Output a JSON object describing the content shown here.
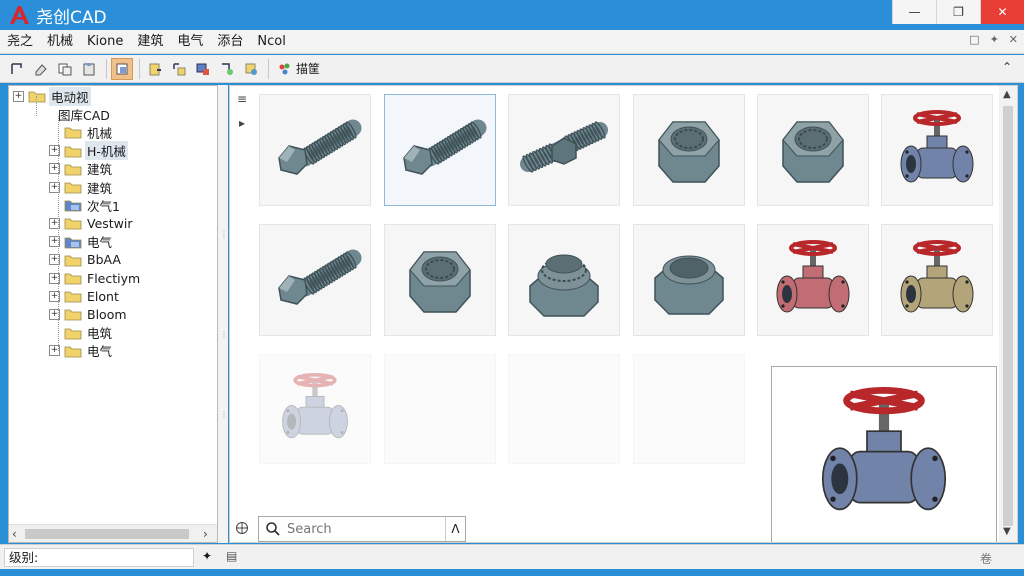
{
  "app": {
    "title": "尧创CAD",
    "accent": "#2a8fd8",
    "logo_color": "#d9262b"
  },
  "window_controls": [
    "minimize",
    "restore",
    "close"
  ],
  "menu": {
    "items": [
      "尧之",
      "机械",
      "Kione",
      "建筑",
      "电气",
      "添台",
      "Ncol"
    ]
  },
  "toolbar": {
    "label_button": "描筐"
  },
  "tree": {
    "items": [
      {
        "label": "电动视",
        "level": 0,
        "expander": "+",
        "icon": "folder"
      },
      {
        "label": "图库CAD",
        "level": 1,
        "expander": "",
        "icon": "none"
      },
      {
        "label": "机械",
        "level": 2,
        "expander": "",
        "icon": "folder"
      },
      {
        "label": "H-机械",
        "level": 2,
        "expander": "+",
        "icon": "folder"
      },
      {
        "label": "建筑",
        "level": 2,
        "expander": "+",
        "icon": "folder"
      },
      {
        "label": "建筑",
        "level": 2,
        "expander": "+",
        "icon": "folder"
      },
      {
        "label": "次气1",
        "level": 2,
        "expander": "",
        "icon": "blue-folder"
      },
      {
        "label": "Vestwir",
        "level": 2,
        "expander": "+",
        "icon": "folder"
      },
      {
        "label": "电气",
        "level": 2,
        "expander": "+",
        "icon": "blue-folder"
      },
      {
        "label": "BbAA",
        "level": 2,
        "expander": "+",
        "icon": "folder"
      },
      {
        "label": "Flectiym",
        "level": 2,
        "expander": "+",
        "icon": "folder"
      },
      {
        "label": "Elont",
        "level": 2,
        "expander": "+",
        "icon": "folder"
      },
      {
        "label": "Bloom",
        "level": 2,
        "expander": "+",
        "icon": "folder"
      },
      {
        "label": "电筑",
        "level": 2,
        "expander": "",
        "icon": "folder"
      },
      {
        "label": "电气",
        "level": 2,
        "expander": "+",
        "icon": "folder"
      }
    ]
  },
  "thumbnails": [
    {
      "name": "bolt-long",
      "row": 0,
      "state": "normal"
    },
    {
      "name": "bolt-long",
      "row": 0,
      "state": "selected"
    },
    {
      "name": "stud-bolt",
      "row": 0,
      "state": "normal"
    },
    {
      "name": "hex-nut",
      "row": 0,
      "state": "normal"
    },
    {
      "name": "hex-nut",
      "row": 0,
      "state": "normal"
    },
    {
      "name": "valve-blue",
      "row": 0,
      "state": "normal"
    },
    {
      "name": "bolt-long",
      "row": 1,
      "state": "normal"
    },
    {
      "name": "hex-nut",
      "row": 1,
      "state": "normal"
    },
    {
      "name": "flange-nut",
      "row": 1,
      "state": "normal"
    },
    {
      "name": "round-nut",
      "row": 1,
      "state": "normal"
    },
    {
      "name": "valve-red",
      "row": 1,
      "state": "normal"
    },
    {
      "name": "valve-olive",
      "row": 1,
      "state": "normal"
    }
  ],
  "preview": {
    "name": "valve-blue"
  },
  "search": {
    "placeholder": "Search"
  },
  "status": {
    "text": "级别:",
    "right": "卷"
  },
  "colors": {
    "metal": "#6f8890",
    "metal_dark": "#3f5258",
    "valve_blue": "#7183a8",
    "valve_red": "#c26c73",
    "valve_olive": "#b3a47a",
    "handwheel": "#b8272a",
    "folder": "#f2d36b"
  }
}
